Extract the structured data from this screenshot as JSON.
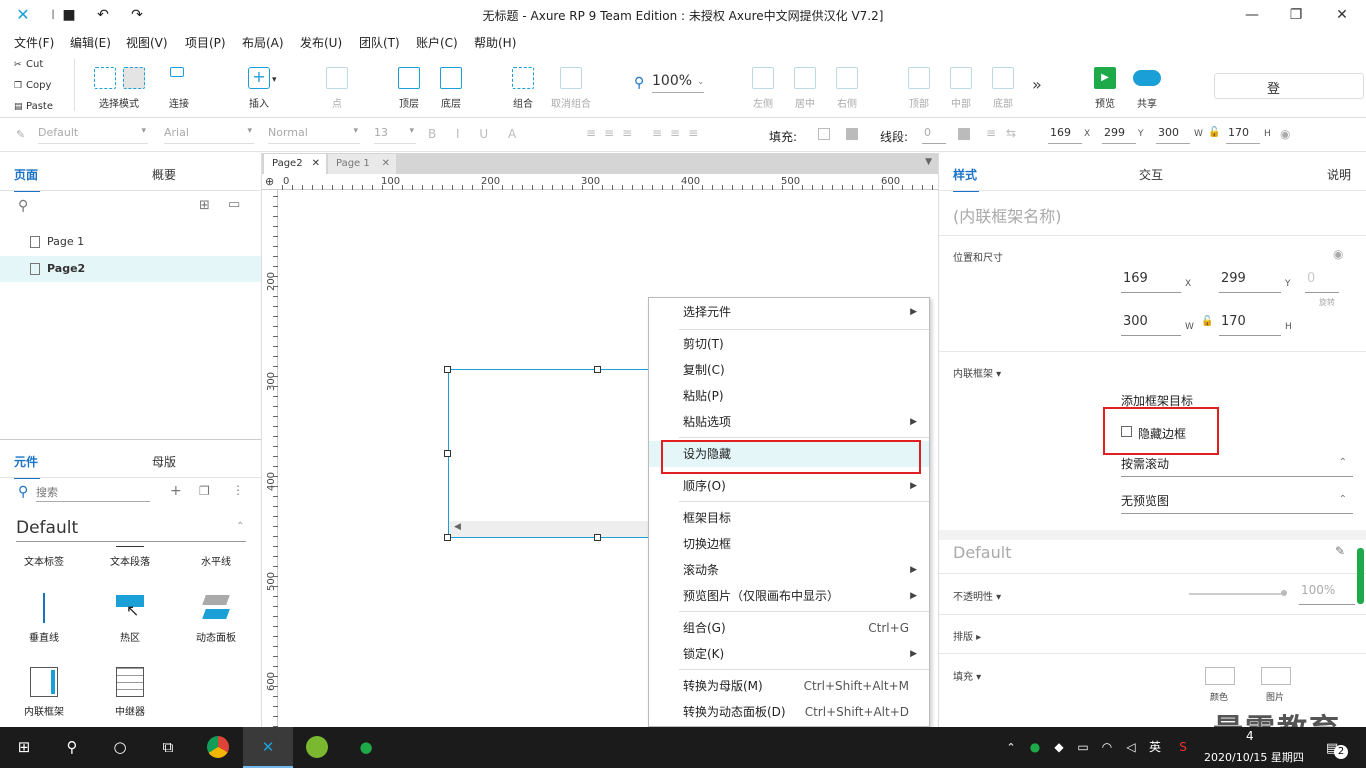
{
  "app": {
    "title": "无标题 - Axure RP 9 Team Edition : 未授权    Axure中文网提供汉化 V7.2]",
    "logo_icon": "axure-logo-icon",
    "accent": "#1a73c6"
  },
  "menubar": {
    "items": [
      "文件(F)",
      "编辑(E)",
      "视图(V)",
      "项目(P)",
      "布局(A)",
      "发布(U)",
      "团队(T)",
      "账户(C)",
      "帮助(H)"
    ]
  },
  "toolbar": {
    "cut": "Cut",
    "copy": "Copy",
    "paste": "Paste",
    "select_mode": "选择模式",
    "connect": "连接",
    "insert": "插入",
    "point": "点",
    "top": "顶层",
    "bottom": "底层",
    "group": "组合",
    "ungroup": "取消组合",
    "zoom": "100%",
    "align_left": "左侧",
    "align_center": "居中",
    "align_right": "右侧",
    "align_top": "顶部",
    "align_middle": "中部",
    "align_bottom": "底部",
    "preview": "预览",
    "share": "共享",
    "login": "登"
  },
  "formatbar": {
    "style": "Default",
    "font": "Arial",
    "weight": "Normal",
    "size": "13",
    "fill_label": "填充:",
    "stroke_label": "线段:",
    "stroke_value": "0",
    "x": "169",
    "y": "299",
    "w": "300",
    "h": "170",
    "x_unit": "X",
    "y_unit": "Y",
    "w_unit": "W",
    "h_unit": "H"
  },
  "leftpanel": {
    "tab_pages": "页面",
    "tab_outline": "概要",
    "pages": [
      "Page 1",
      "Page2"
    ],
    "tab_widgets": "元件",
    "tab_masters": "母版",
    "search_placeholder": "搜索",
    "library": "Default",
    "widgets_row0": [
      "文本标签",
      "文本段落",
      "水平线"
    ],
    "widgets_row1": [
      "垂直线",
      "热区",
      "动态面板"
    ],
    "widgets_row2": [
      "内联框架",
      "中继器"
    ]
  },
  "canvas": {
    "tabs": [
      "Page2",
      "Page 1"
    ],
    "ruler_h": [
      "0",
      "100",
      "200",
      "300",
      "400",
      "500",
      "600"
    ],
    "ruler_v": [
      "200",
      "300",
      "400",
      "500",
      "600"
    ]
  },
  "context_menu": {
    "items": [
      {
        "label": "选择元件",
        "sub": true
      },
      {
        "label": "剪切(T)"
      },
      {
        "label": "复制(C)"
      },
      {
        "label": "粘贴(P)"
      },
      {
        "label": "粘贴选项",
        "sub": true
      },
      {
        "label": "设为隐藏"
      },
      {
        "label": "顺序(O)",
        "sub": true
      },
      {
        "label": "框架目标"
      },
      {
        "label": "切换边框"
      },
      {
        "label": "滚动条",
        "sub": true
      },
      {
        "label": "预览图片（仅限画布中显示）",
        "sub": true
      },
      {
        "label": "组合(G)",
        "shortcut": "Ctrl+G"
      },
      {
        "label": "锁定(K)",
        "sub": true
      },
      {
        "label": "转换为母版(M)",
        "shortcut": "Ctrl+Shift+Alt+M"
      },
      {
        "label": "转换为动态面板(D)",
        "shortcut": "Ctrl+Shift+Alt+D"
      }
    ]
  },
  "rightpanel": {
    "tab_style": "样式",
    "tab_interact": "交互",
    "tab_notes": "说明",
    "name_placeholder": "(内联框架名称)",
    "pos_size_label": "位置和尺寸",
    "x": "169",
    "y": "299",
    "rotation": "0",
    "rotation_label": "旋转",
    "w": "300",
    "h": "170",
    "x_unit": "X",
    "y_unit": "Y",
    "w_unit": "W",
    "h_unit": "H",
    "iframe_section": "内联框架 ▾",
    "add_target": "添加框架目标",
    "hide_border": "隐藏边框",
    "scroll_option": "按需滚动",
    "preview_option": "无预览图",
    "style_name": "Default",
    "opacity_label": "不透明性 ▾",
    "opacity_value": "100%",
    "layout_label": "排版 ▸",
    "fill_label": "填充 ▾",
    "fill_color": "颜色",
    "fill_image": "图片"
  },
  "watermark": "最需教育",
  "taskbar": {
    "lang": "英",
    "time_fragment": "4",
    "date": "2020/10/15 星期四",
    "notification_count": "2"
  }
}
